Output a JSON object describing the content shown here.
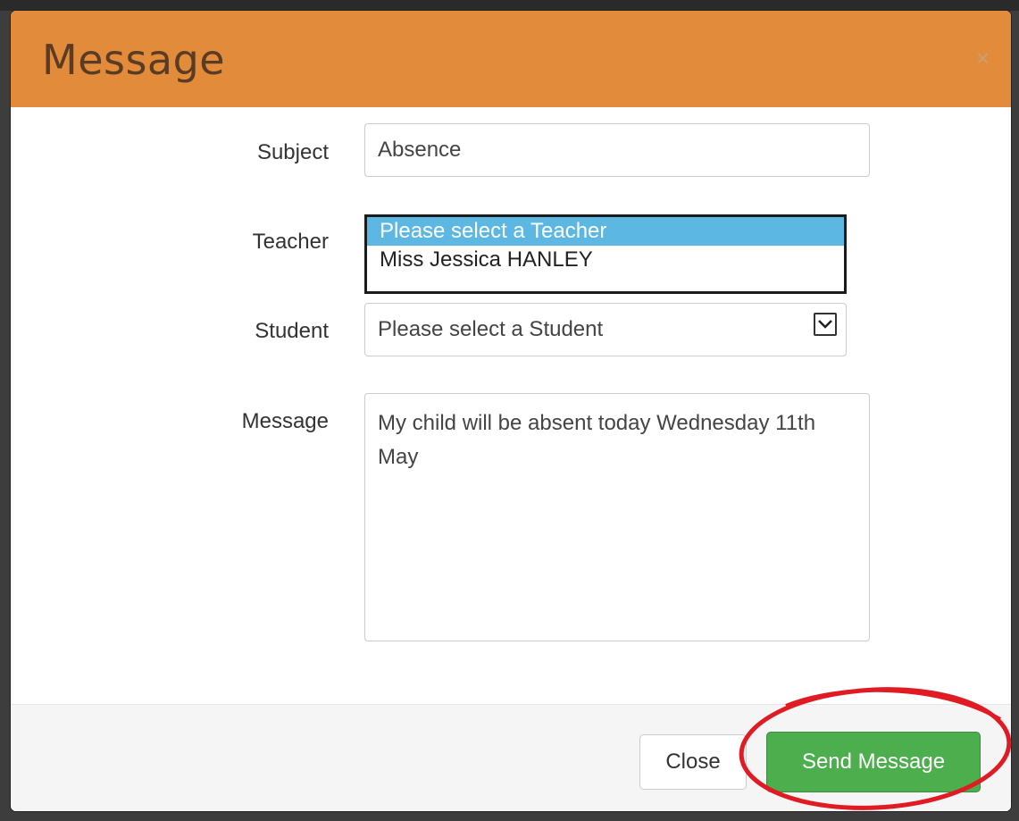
{
  "modal": {
    "title": "Message",
    "close_glyph": "×"
  },
  "form": {
    "subject_label": "Subject",
    "subject_value": "Absence",
    "teacher_label": "Teacher",
    "teacher_options": [
      "Please select a Teacher",
      "Miss Jessica HANLEY"
    ],
    "teacher_selected_index": 0,
    "student_label": "Student",
    "student_value": "Please select a Student",
    "message_label": "Message",
    "message_value": "My child will be absent today Wednesday 11th May"
  },
  "footer": {
    "close_label": "Close",
    "send_label": "Send Message"
  },
  "colors": {
    "header": "#e28b3a",
    "send_button": "#4cae4c",
    "selected_option": "#5cb8e3",
    "highlight_circle": "#e01b24"
  },
  "icons": {
    "dropdown": "chevron-down-icon",
    "close": "close-icon"
  }
}
